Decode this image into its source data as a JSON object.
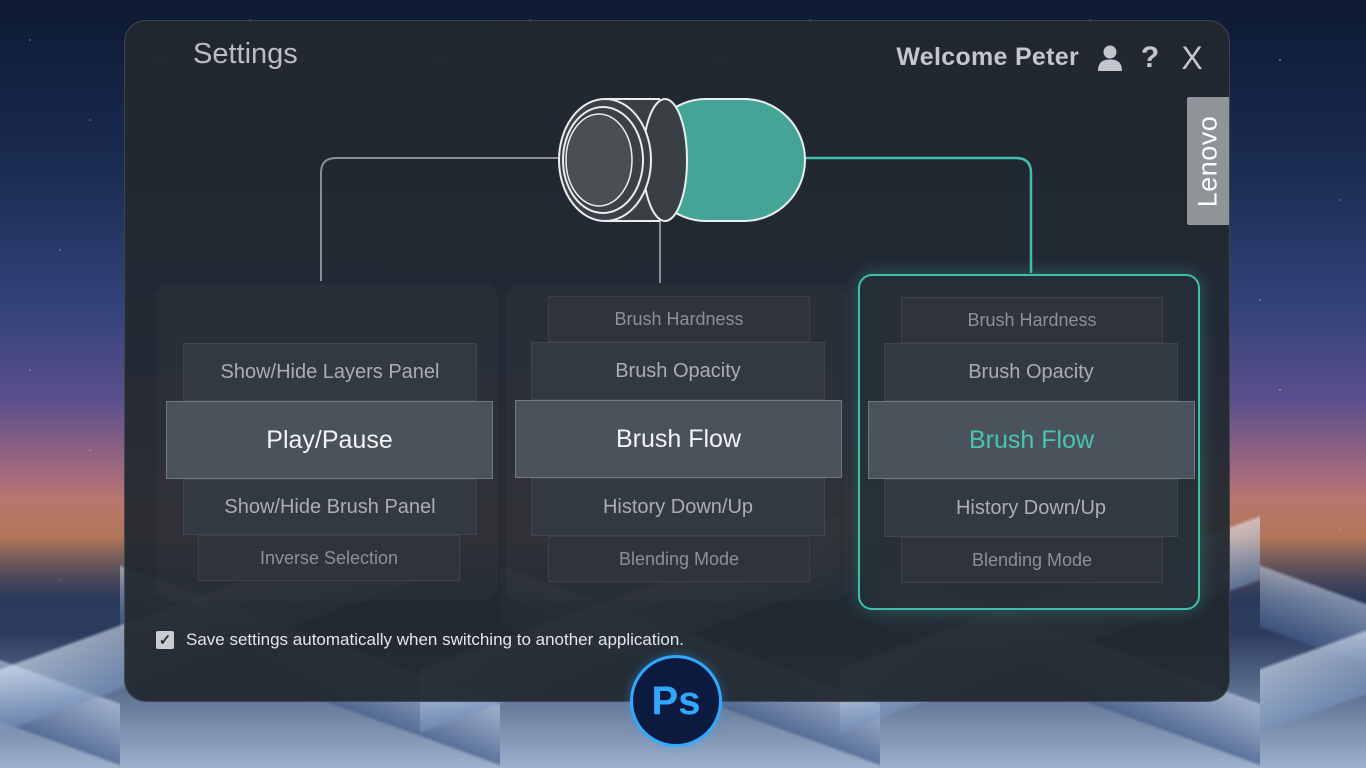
{
  "header": {
    "title": "Settings",
    "welcome": "Welcome Peter",
    "help_glyph": "?",
    "close_glyph": "X",
    "brand": "Lenovo"
  },
  "icons": [
    "user-icon",
    "help-icon",
    "close-icon",
    "check-icon"
  ],
  "colors": {
    "accent": "#3fbfaa",
    "dial_fill": "#44a596",
    "ps_blue": "#31a8ff",
    "panel_bg": "#22282f"
  },
  "columns": {
    "left": {
      "items": [
        "Show/Hide Layers Panel",
        "Play/Pause",
        "Show/Hide Brush Panel",
        "Inverse Selection"
      ],
      "selected": "Play/Pause"
    },
    "middle": {
      "items": [
        "Brush Hardness",
        "Brush Opacity",
        "Brush Flow",
        "History Down/Up",
        "Blending Mode"
      ],
      "selected": "Brush Flow"
    },
    "right": {
      "items": [
        "Brush Hardness",
        "Brush Opacity",
        "Brush Flow",
        "History Down/Up",
        "Blending Mode"
      ],
      "selected": "Brush Flow"
    }
  },
  "save_setting": {
    "checked": true,
    "label": "Save settings automatically when switching to another application."
  },
  "app_badge": "Ps"
}
